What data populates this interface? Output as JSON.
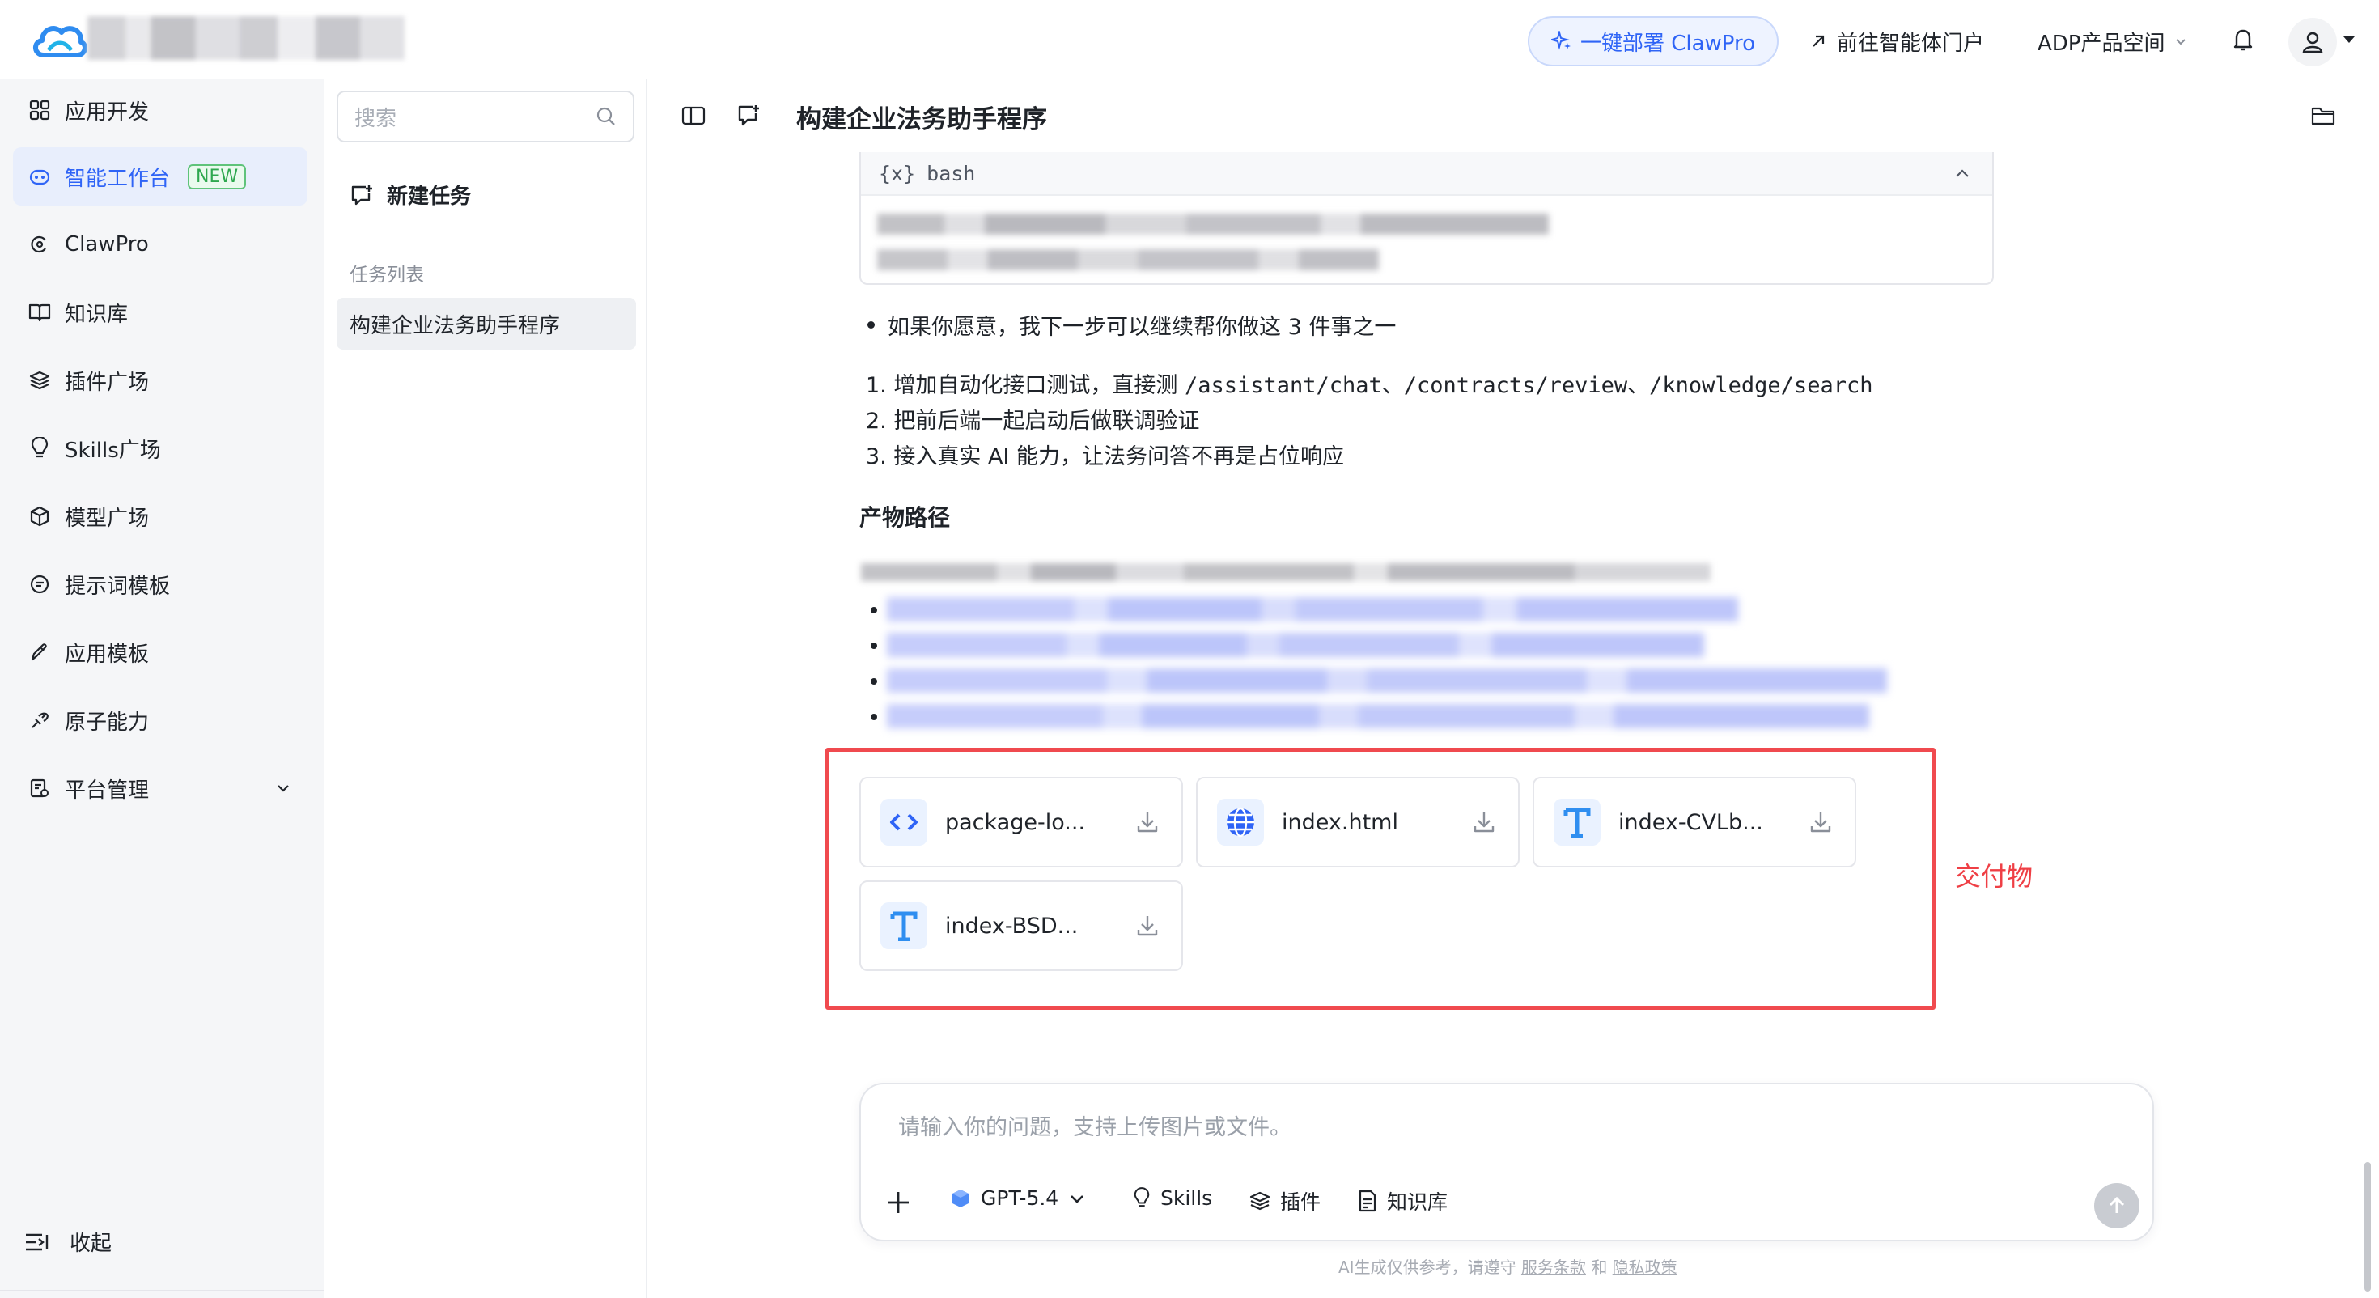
{
  "topbar": {
    "deploy_label": "一键部署 ClawPro",
    "portal_label": "前往智能体门户",
    "product_space_label": "ADP产品空间"
  },
  "sidebar": {
    "items": [
      {
        "label": "应用开发",
        "icon": "grid-icon"
      },
      {
        "label": "智能工作台",
        "icon": "robot-icon",
        "badge": "NEW",
        "active": true
      },
      {
        "label": "ClawPro",
        "icon": "claw-icon"
      },
      {
        "label": "知识库",
        "icon": "book-icon"
      },
      {
        "label": "插件广场",
        "icon": "layers-icon"
      },
      {
        "label": "Skills广场",
        "icon": "bulb-icon"
      },
      {
        "label": "模型广场",
        "icon": "cube-icon"
      },
      {
        "label": "提示词模板",
        "icon": "chat-icon"
      },
      {
        "label": "应用模板",
        "icon": "pen-icon"
      },
      {
        "label": "原子能力",
        "icon": "atom-icon"
      },
      {
        "label": "平台管理",
        "icon": "admin-icon",
        "expandable": true
      }
    ],
    "collapse_label": "收起"
  },
  "tasks": {
    "search_placeholder": "搜索",
    "new_task_label": "新建任务",
    "list_label": "任务列表",
    "items": [
      "构建企业法务助手程序"
    ]
  },
  "chat": {
    "title": "构建企业法务助手程序",
    "code_block": {
      "lang_icon": "{x}",
      "lang": "bash"
    },
    "offer_line": "如果你愿意，我下一步可以继续帮你做这 3 件事之一",
    "steps": [
      {
        "num": "1.",
        "text_before": "增加自动化接口测试，直接测 ",
        "code": "/assistant/chat、/contracts/review、/knowledge/search"
      },
      {
        "num": "2.",
        "text": "把前后端一起启动后做联调验证"
      },
      {
        "num": "3.",
        "text": "接入真实 AI 能力，让法务问答不再是占位响应"
      }
    ],
    "artifacts_heading": "产物路径",
    "deliverables_annotation": "交付物",
    "files": [
      {
        "name": "package-lo...",
        "icon": "code-file-icon",
        "color": "#2f64f6"
      },
      {
        "name": "index.html",
        "icon": "globe-file-icon",
        "color": "#2f64f6"
      },
      {
        "name": "index-CVLb...",
        "icon": "text-file-icon",
        "color": "#2f8ef0"
      },
      {
        "name": "index-BSD...",
        "icon": "text-file-icon",
        "color": "#2f8ef0"
      }
    ]
  },
  "composer": {
    "placeholder": "请输入你的问题，支持上传图片或文件。",
    "model_label": "GPT-5.4",
    "skills_label": "Skills",
    "plugins_label": "插件",
    "knowledge_label": "知识库"
  },
  "footer": {
    "prefix": "AI生成仅供参考，请遵守",
    "terms": "服务条款",
    "and": "和",
    "privacy": "隐私政策"
  },
  "colors": {
    "accent": "#2f64f6",
    "highlight": "#f04a4f",
    "new_badge": "#2fa84f"
  }
}
